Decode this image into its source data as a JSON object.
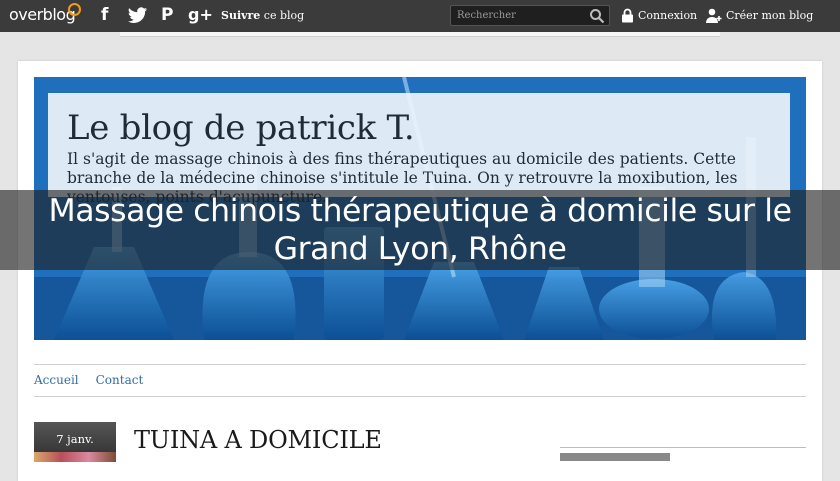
{
  "topbar": {
    "logo_main": "overblog",
    "social": {
      "facebook_glyph": "f",
      "facebook_icon": "facebook-icon",
      "twitter_icon": "twitter-icon",
      "pinterest_glyph": "P",
      "pinterest_icon": "pinterest-icon",
      "googleplus_glyph": "g+",
      "googleplus_icon": "googleplus-icon"
    },
    "follow_strong": "Suivre",
    "follow_rest": " ce blog",
    "search_placeholder": "Rechercher",
    "login_label": "Connexion",
    "signup_label": "Créer mon blog"
  },
  "banner": {
    "title": "Le blog de patrick T.",
    "description": "Il s'agit de massage chinois à des fins thérapeutiques au domicile des patients. Cette branche de la médecine chinoise s'intitule le Tuina. On y retrouvre la moxibution, les ventouses, points d'acupuncture.."
  },
  "overlay": {
    "title": "Massage chinois thérapeutique à domicile sur le Grand Lyon, Rhône"
  },
  "nav": {
    "home": "Accueil",
    "contact": "Contact"
  },
  "post": {
    "date": "7 janv.",
    "title": "TUINA A DOMICILE"
  },
  "colors": {
    "topbar": "#3b3b3b",
    "accent_link": "#2e6da4",
    "banner_blue": "#2578c4"
  }
}
